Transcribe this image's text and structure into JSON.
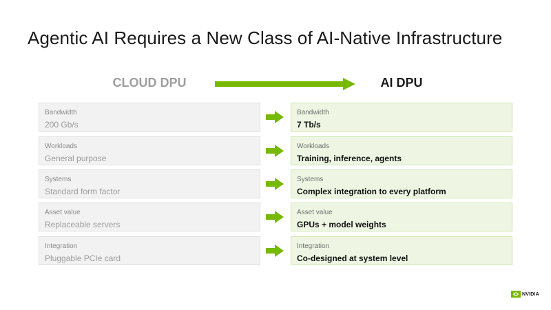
{
  "title": "Agentic AI Requires a New Class of AI-Native Infrastructure",
  "header": {
    "left": "CLOUD DPU",
    "right": "AI DPU"
  },
  "colors": {
    "accent_green": "#76b900",
    "left_box_bg": "#f2f2f2",
    "right_box_bg": "#eef6e3"
  },
  "rows": [
    {
      "label": "Bandwidth",
      "left_value": "200 Gb/s",
      "right_value": "7 Tb/s"
    },
    {
      "label": "Workloads",
      "left_value": "General purpose",
      "right_value": "Training, inference, agents"
    },
    {
      "label": "Systems",
      "left_value": "Standard form factor",
      "right_value": "Complex integration to every platform"
    },
    {
      "label": "Asset value",
      "left_value": "Replaceable servers",
      "right_value": "GPUs + model weights"
    },
    {
      "label": "Integration",
      "left_value": "Pluggable PCIe card",
      "right_value": "Co-designed at system level"
    }
  ],
  "logo": {
    "text": "NVIDIA",
    "icon": "nvidia-eye-logo-icon"
  }
}
